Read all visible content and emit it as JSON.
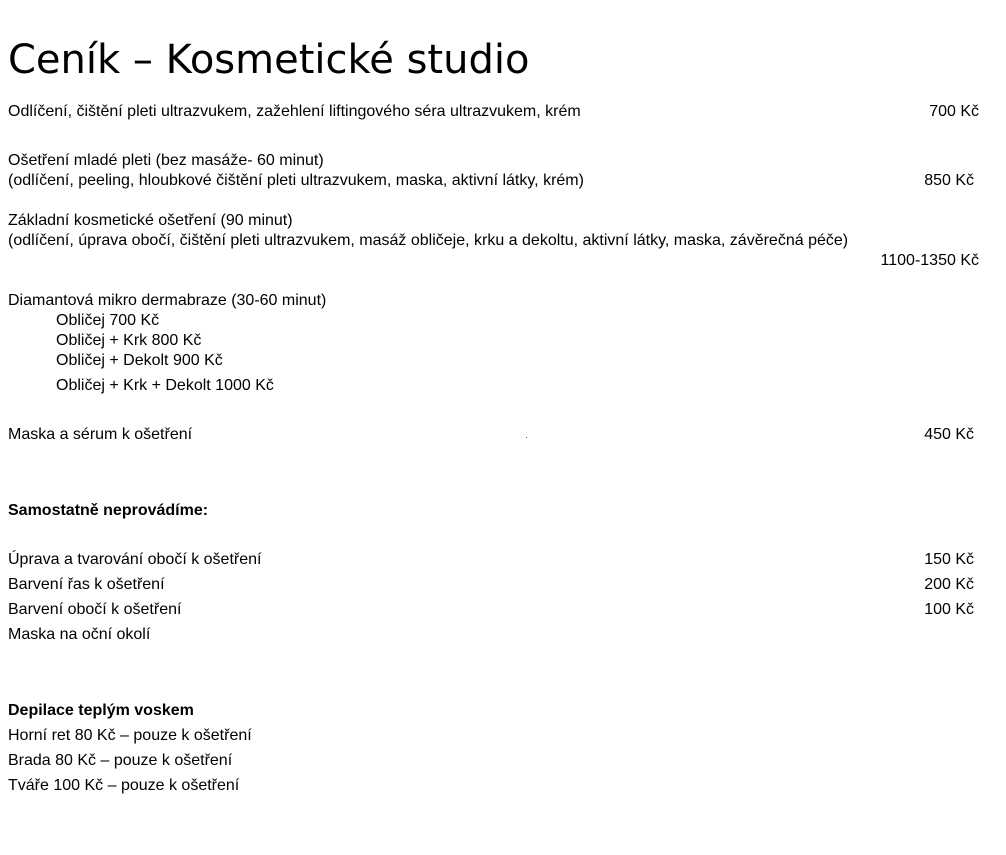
{
  "title": "Ceník – Kosmetické studio",
  "services": [
    {
      "text": "Odlíčení, čištění pleti ultrazvukem, zažehlení  liftingového séra ultrazvukem, krém",
      "price": "700 Kč"
    },
    {
      "line1": "Ošetření mladé pleti (bez masáže- 60 minut)",
      "line2": "(odlíčení, peeling, hloubkové čištění pleti ultrazvukem, maska, aktivní látky, krém)",
      "price": "850 Kč"
    },
    {
      "line1": "Základní kosmetické ošetření (90 minut)",
      "line2": "(odlíčení, úprava obočí, čištění pleti ultrazvukem, masáž obličeje, krku a dekoltu, aktivní látky, maska, závěrečná péče)",
      "price": "1100-1350  Kč"
    }
  ],
  "diamond": {
    "heading": "Diamantová mikro dermabraze (30-60 minut)",
    "items": [
      "Obličej 700 Kč",
      "Obličej + Krk 800 Kč",
      "Obličej + Dekolt 900 Kč",
      "Obličej + Krk + Dekolt 1000 Kč"
    ]
  },
  "mask": {
    "text": "Maska a sérum k ošetření",
    "price": "450 Kč"
  },
  "separate": {
    "heading": "Samostatně neprovádíme:",
    "items": [
      {
        "text": "Úprava a tvarování obočí  k ošetření",
        "price": "150 Kč"
      },
      {
        "text": "Barvení řas  k ošetření",
        "price": "200 Kč"
      },
      {
        "text": "Barvení obočí  k ošetření",
        "price": "100 Kč"
      },
      {
        "text": "Maska na oční okolí",
        "price": ""
      }
    ]
  },
  "wax": {
    "heading": "Depilace teplým voskem",
    "items": [
      "Horní ret  80 Kč – pouze k ošetření",
      "Brada  80 Kč – pouze k ošetření",
      "Tváře  100 Kč – pouze k ošetření"
    ]
  }
}
